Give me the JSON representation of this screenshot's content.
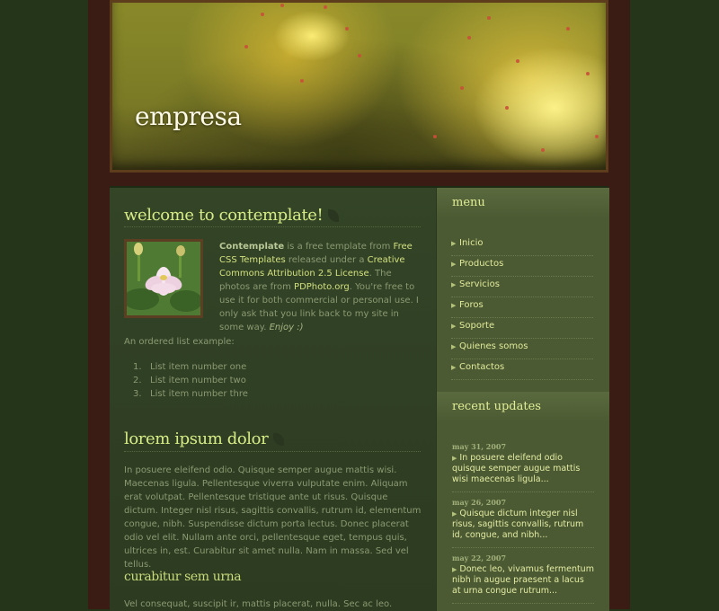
{
  "header": {
    "site_title": "empresa"
  },
  "main": {
    "welcome_title": "welcome to contemplate!",
    "intro": {
      "brand": "Contemplate",
      "t1": " is a free template from ",
      "link1": "Free CSS Templates",
      "t2": " released under a ",
      "link2": "Creative Commons Attribution 2.5 License",
      "t3": ". The photos are from ",
      "link3": "PDPhoto.org",
      "t4": ". You're free to use it for both commercial or personal use. I only ask that you link back to my site in some way. ",
      "enjoy": "Enjoy :)"
    },
    "ordered_list_label": "An ordered list example:",
    "ordered_list": [
      {
        "num": "1.",
        "text": "List item number one"
      },
      {
        "num": "2.",
        "text": "List item number two"
      },
      {
        "num": "3.",
        "text": "List item number thre"
      }
    ],
    "lorem_title": "lorem ipsum dolor",
    "lorem_text": "In posuere eleifend odio. Quisque semper augue mattis wisi. Maecenas ligula. Pellentesque viverra vulputate enim. Aliquam erat volutpat. Pellentesque tristique ante ut risus. Quisque dictum. Integer nisl risus, sagittis convallis, rutrum id, elementum congue, nibh. Suspendisse dictum porta lectus. Donec placerat odio vel elit. Nullam ante orci, pellentesque eget, tempus quis, ultrices in, est. Curabitur sit amet nulla. Nam in massa. Sed vel tellus.",
    "curabitur_title": "curabitur sem urna",
    "curabitur_text": "Vel consequat, suscipit ir, mattis placerat, nulla. Sec ac leo."
  },
  "sidebar": {
    "menu_title": "menu",
    "menu_items": [
      "Inicio",
      "Productos",
      "Servicios",
      "Foros",
      "Soporte",
      "Quienes somos",
      "Contactos"
    ],
    "updates_title": "recent updates",
    "updates": [
      {
        "date": "may 31, 2007",
        "text": "In posuere eleifend odio quisque semper augue mattis wisi maecenas ligula..."
      },
      {
        "date": "may 26, 2007",
        "text": "Quisque dictum integer nisl risus, sagittis convallis, rutrum id, congue, and nibh..."
      },
      {
        "date": "may 22, 2007",
        "text": "Donec leo, vivamus fermentum nibh in augue praesent a lacus at urna congue rutrum..."
      }
    ]
  },
  "colors": {
    "page_bg": "#253519",
    "heading": "#d7ec86",
    "link": "#d2e07e",
    "body_text": "#8b9a72"
  }
}
